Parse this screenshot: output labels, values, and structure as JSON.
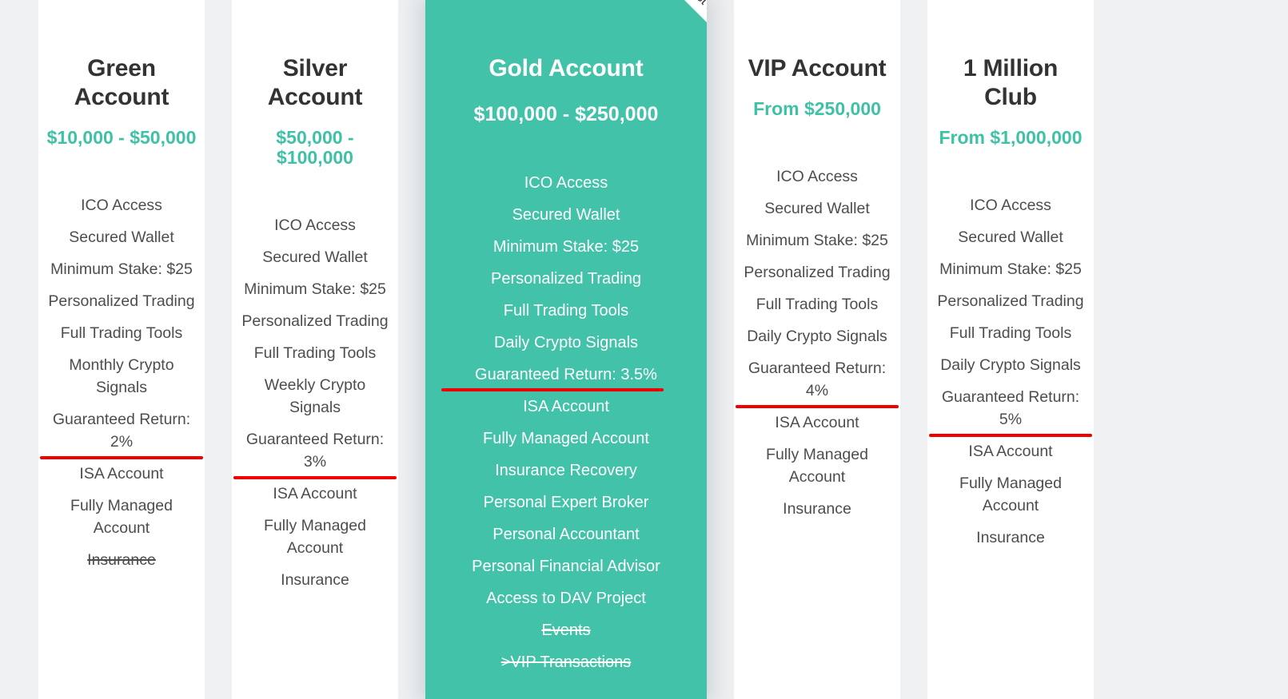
{
  "page": {
    "background_color": "#eef0f2",
    "accent_color": "#3fc1a6",
    "featured_background_color": "#42c2a8",
    "highlight_rule_color": "#f10000",
    "text_color": "#4d4d4d",
    "heading_color": "#333333"
  },
  "ribbon": {
    "label": "Best match",
    "icon": "corner-ribbon"
  },
  "plans": [
    {
      "id": "green-account",
      "title": "Green Account",
      "price": "$10,000 - $50,000",
      "featured": false,
      "features": [
        {
          "label": "ICO Access",
          "struck": false,
          "ruled": false
        },
        {
          "label": "Secured Wallet",
          "struck": false,
          "ruled": false
        },
        {
          "label": "Minimum Stake: $25",
          "struck": false,
          "ruled": false
        },
        {
          "label": "Personalized Trading",
          "struck": false,
          "ruled": false
        },
        {
          "label": "Full Trading Tools",
          "struck": false,
          "ruled": false
        },
        {
          "label": "Monthly Crypto Signals",
          "struck": false,
          "ruled": false
        },
        {
          "label": "Guaranteed Return: 2%",
          "struck": false,
          "ruled": true
        },
        {
          "label": "ISA Account",
          "struck": false,
          "ruled": false
        },
        {
          "label": "Fully Managed Account",
          "struck": false,
          "ruled": false
        },
        {
          "label": "Insurance",
          "struck": true,
          "ruled": false
        }
      ]
    },
    {
      "id": "silver-account",
      "title": "Silver Account",
      "price": "$50,000 - $100,000",
      "featured": false,
      "features": [
        {
          "label": "ICO Access",
          "struck": false,
          "ruled": false
        },
        {
          "label": "Secured Wallet",
          "struck": false,
          "ruled": false
        },
        {
          "label": "Minimum Stake: $25",
          "struck": false,
          "ruled": false
        },
        {
          "label": "Personalized Trading",
          "struck": false,
          "ruled": false
        },
        {
          "label": "Full Trading Tools",
          "struck": false,
          "ruled": false
        },
        {
          "label": "Weekly Crypto Signals",
          "struck": false,
          "ruled": false
        },
        {
          "label": "Guaranteed Return: 3%",
          "struck": false,
          "ruled": true
        },
        {
          "label": "ISA Account",
          "struck": false,
          "ruled": false
        },
        {
          "label": "Fully Managed Account",
          "struck": false,
          "ruled": false
        },
        {
          "label": "Insurance",
          "struck": false,
          "ruled": false
        }
      ]
    },
    {
      "id": "gold-account",
      "title": "Gold Account",
      "price": "$100,000 - $250,000",
      "featured": true,
      "features": [
        {
          "label": "ICO Access",
          "struck": false,
          "ruled": false
        },
        {
          "label": "Secured Wallet",
          "struck": false,
          "ruled": false
        },
        {
          "label": "Minimum Stake: $25",
          "struck": false,
          "ruled": false
        },
        {
          "label": "Personalized Trading",
          "struck": false,
          "ruled": false
        },
        {
          "label": "Full Trading Tools",
          "struck": false,
          "ruled": false
        },
        {
          "label": "Daily Crypto Signals",
          "struck": false,
          "ruled": false
        },
        {
          "label": "Guaranteed Return: 3.5%",
          "struck": false,
          "ruled": true
        },
        {
          "label": "ISA Account",
          "struck": false,
          "ruled": false
        },
        {
          "label": "Fully Managed Account",
          "struck": false,
          "ruled": false
        },
        {
          "label": "Insurance Recovery",
          "struck": false,
          "ruled": false
        },
        {
          "label": "Personal Expert Broker",
          "struck": false,
          "ruled": false
        },
        {
          "label": "Personal Accountant",
          "struck": false,
          "ruled": false
        },
        {
          "label": "Personal Financial Advisor",
          "struck": false,
          "ruled": false
        },
        {
          "label": "Access to DAV Project",
          "struck": false,
          "ruled": false
        },
        {
          "label": "Events",
          "struck": true,
          "ruled": false
        },
        {
          "label": ">VIP Transactions",
          "struck": true,
          "ruled": false
        }
      ]
    },
    {
      "id": "vip-account",
      "title": "VIP Account",
      "price": "From $250,000",
      "featured": false,
      "features": [
        {
          "label": "ICO Access",
          "struck": false,
          "ruled": false
        },
        {
          "label": "Secured Wallet",
          "struck": false,
          "ruled": false
        },
        {
          "label": "Minimum Stake: $25",
          "struck": false,
          "ruled": false
        },
        {
          "label": "Personalized Trading",
          "struck": false,
          "ruled": false
        },
        {
          "label": "Full Trading Tools",
          "struck": false,
          "ruled": false
        },
        {
          "label": "Daily Crypto Signals",
          "struck": false,
          "ruled": false
        },
        {
          "label": "Guaranteed Return: 4%",
          "struck": false,
          "ruled": true
        },
        {
          "label": "ISA Account",
          "struck": false,
          "ruled": false
        },
        {
          "label": "Fully Managed Account",
          "struck": false,
          "ruled": false
        },
        {
          "label": "Insurance",
          "struck": false,
          "ruled": false
        }
      ]
    },
    {
      "id": "one-million-club",
      "title": "1 Million Club",
      "price": "From $1,000,000",
      "featured": false,
      "features": [
        {
          "label": "ICO Access",
          "struck": false,
          "ruled": false
        },
        {
          "label": "Secured Wallet",
          "struck": false,
          "ruled": false
        },
        {
          "label": "Minimum Stake: $25",
          "struck": false,
          "ruled": false
        },
        {
          "label": "Personalized Trading",
          "struck": false,
          "ruled": false
        },
        {
          "label": "Full Trading Tools",
          "struck": false,
          "ruled": false
        },
        {
          "label": "Daily Crypto Signals",
          "struck": false,
          "ruled": false
        },
        {
          "label": "Guaranteed Return: 5%",
          "struck": false,
          "ruled": true
        },
        {
          "label": "ISA Account",
          "struck": false,
          "ruled": false
        },
        {
          "label": "Fully Managed Account",
          "struck": false,
          "ruled": false
        },
        {
          "label": "Insurance",
          "struck": false,
          "ruled": false
        }
      ]
    }
  ]
}
